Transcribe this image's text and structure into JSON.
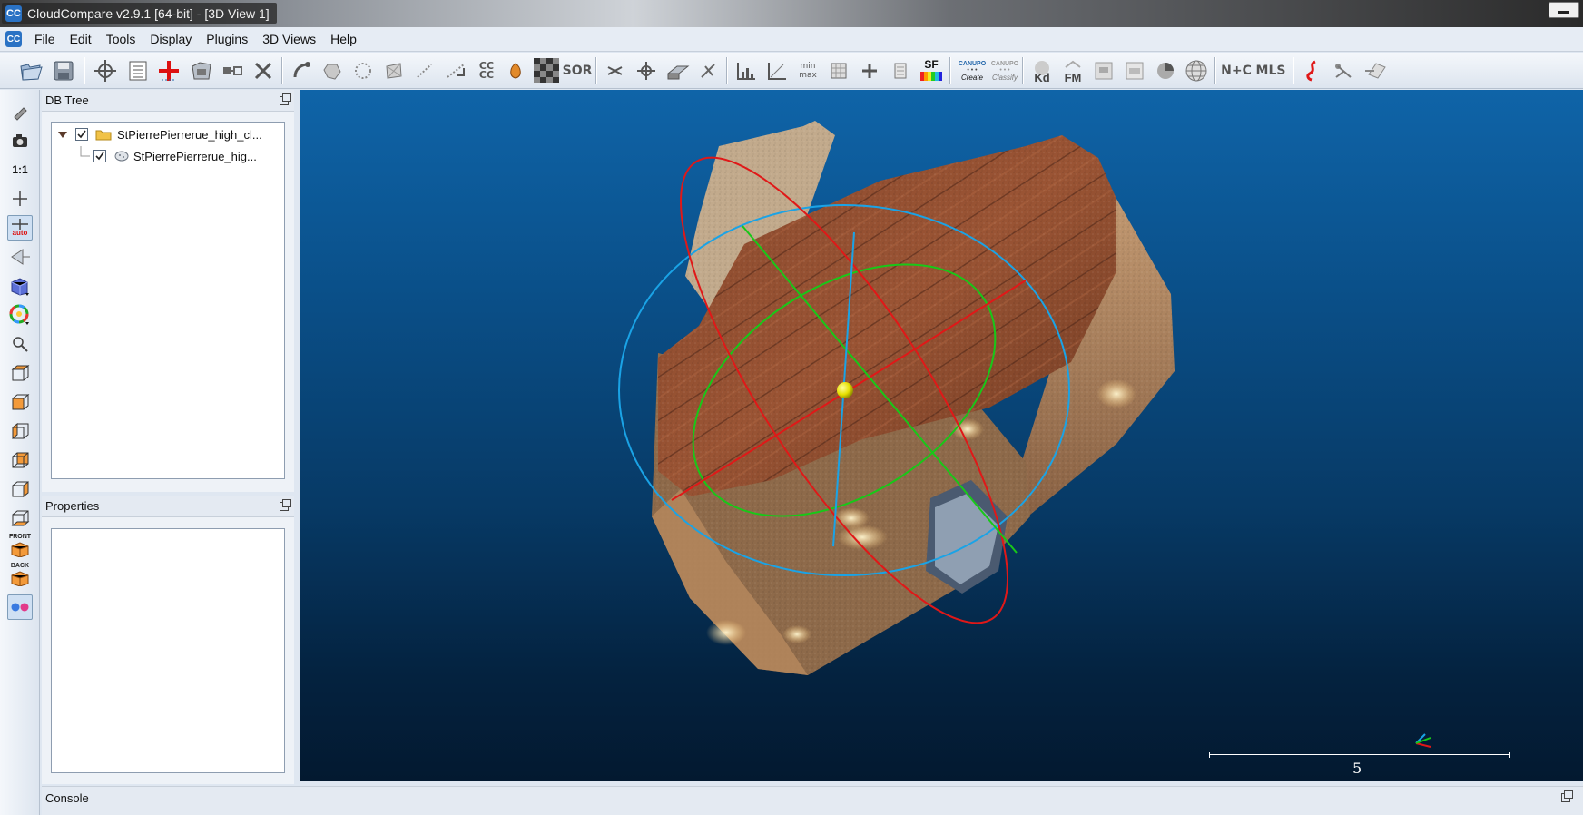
{
  "window": {
    "title": "CloudCompare v2.9.1 [64-bit] - [3D View 1]",
    "app_icon_text": "CC"
  },
  "menu": [
    "File",
    "Edit",
    "Tools",
    "Display",
    "Plugins",
    "3D Views",
    "Help"
  ],
  "toolbar": {
    "cccc_label": "CC\nCC",
    "sor_label": "SOR",
    "minmax_label": "min max",
    "sf_label": "SF",
    "canupo_create_top": "CANUPO",
    "canupo_create_label": "Create",
    "canupo_classify_top": "CANUPO",
    "canupo_classify_label": "Classify",
    "kd_label": "Kd",
    "fm_label": "FM",
    "nc_label": "N+C",
    "mls_label": "MLS"
  },
  "vtoolbar": {
    "ratio_label": "1:1",
    "auto_label": "auto",
    "front_label": "FRONT",
    "back_label": "BACK"
  },
  "db_tree": {
    "title": "DB Tree",
    "items": [
      {
        "label": "StPierrePierrerue_high_cl...",
        "checked": true,
        "type": "folder"
      },
      {
        "label": "StPierrePierrerue_hig...",
        "checked": true,
        "type": "cloud"
      }
    ]
  },
  "properties": {
    "title": "Properties"
  },
  "view": {
    "scale_value": "5"
  },
  "console": {
    "title": "Console"
  },
  "colors": {
    "accent": "#2a72c4",
    "sphere_red": "#e01818",
    "sphere_green": "#18c818",
    "sphere_blue": "#1aa3e6"
  }
}
